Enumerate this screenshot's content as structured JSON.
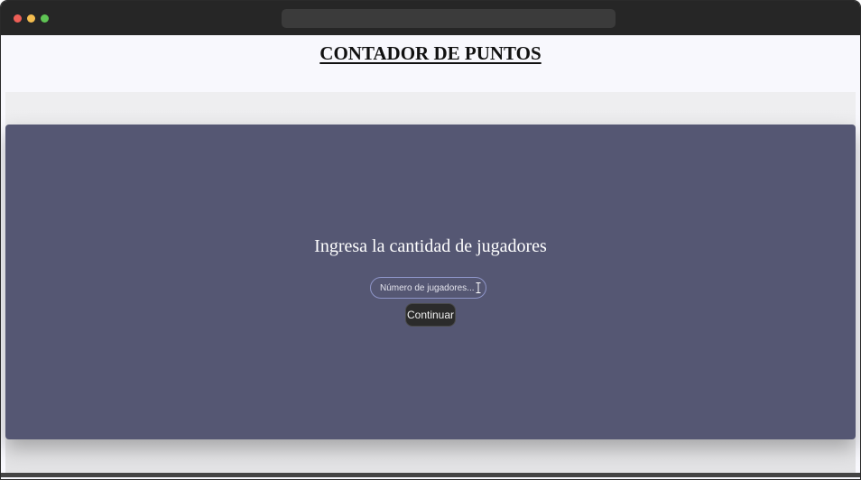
{
  "page": {
    "title": "CONTADOR DE PUNTOS"
  },
  "setup": {
    "prompt": "Ingresa la cantidad de jugadores",
    "players_input": {
      "value": "",
      "placeholder": "Número de jugadores..."
    },
    "continue_label": "Continuar"
  },
  "colors": {
    "card_background": "#555773",
    "button_background": "#2b2b2b",
    "input_border": "#8e95c8",
    "page_background": "#f8f8fd",
    "titlebar": "#262626"
  },
  "icons": {
    "text_cursor": "text-cursor-icon"
  }
}
